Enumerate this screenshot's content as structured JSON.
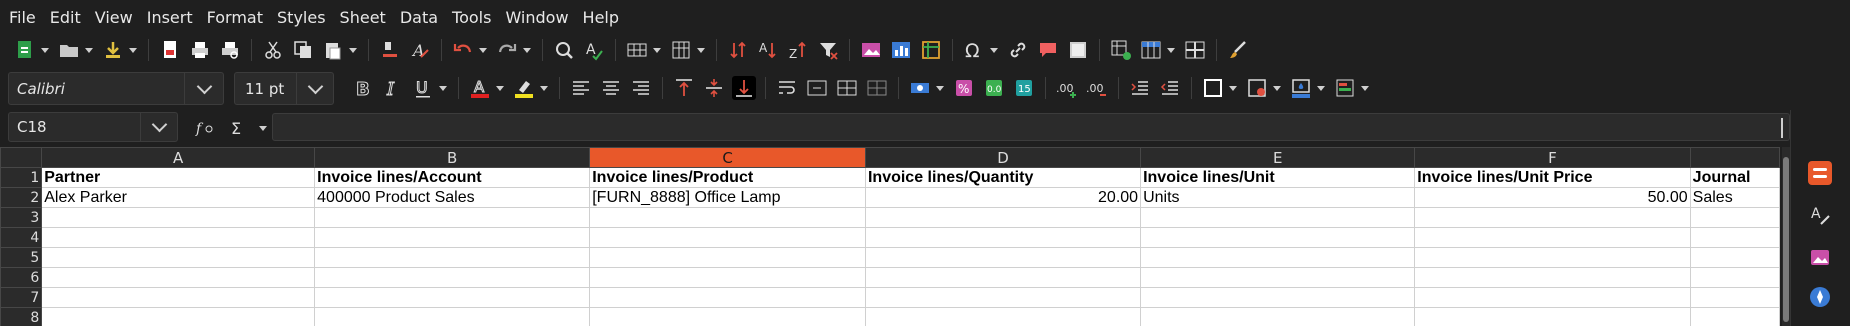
{
  "menu": [
    "File",
    "Edit",
    "View",
    "Insert",
    "Format",
    "Styles",
    "Sheet",
    "Data",
    "Tools",
    "Window",
    "Help"
  ],
  "font": {
    "name": "Calibri",
    "size": "11 pt"
  },
  "cell_ref": "C18",
  "formula": "",
  "columns": [
    "A",
    "B",
    "C",
    "D",
    "E",
    "F"
  ],
  "selected_column": "C",
  "rows": [
    "1",
    "2",
    "3",
    "4",
    "5",
    "6",
    "7",
    "8"
  ],
  "headers": [
    "Partner",
    "Invoice lines/Account",
    "Invoice lines/Product",
    "Invoice lines/Quantity",
    "Invoice lines/Unit",
    "Invoice lines/Unit Price",
    "Journal"
  ],
  "data_row": [
    "Alex Parker",
    "400000 Product Sales",
    "[FURN_8888] Office Lamp",
    "20.00",
    "Units",
    "50.00",
    "Sales"
  ],
  "colors": {
    "accent": "#e8582a",
    "background": "#1f1f1f",
    "grid": "#d0d0d0"
  }
}
